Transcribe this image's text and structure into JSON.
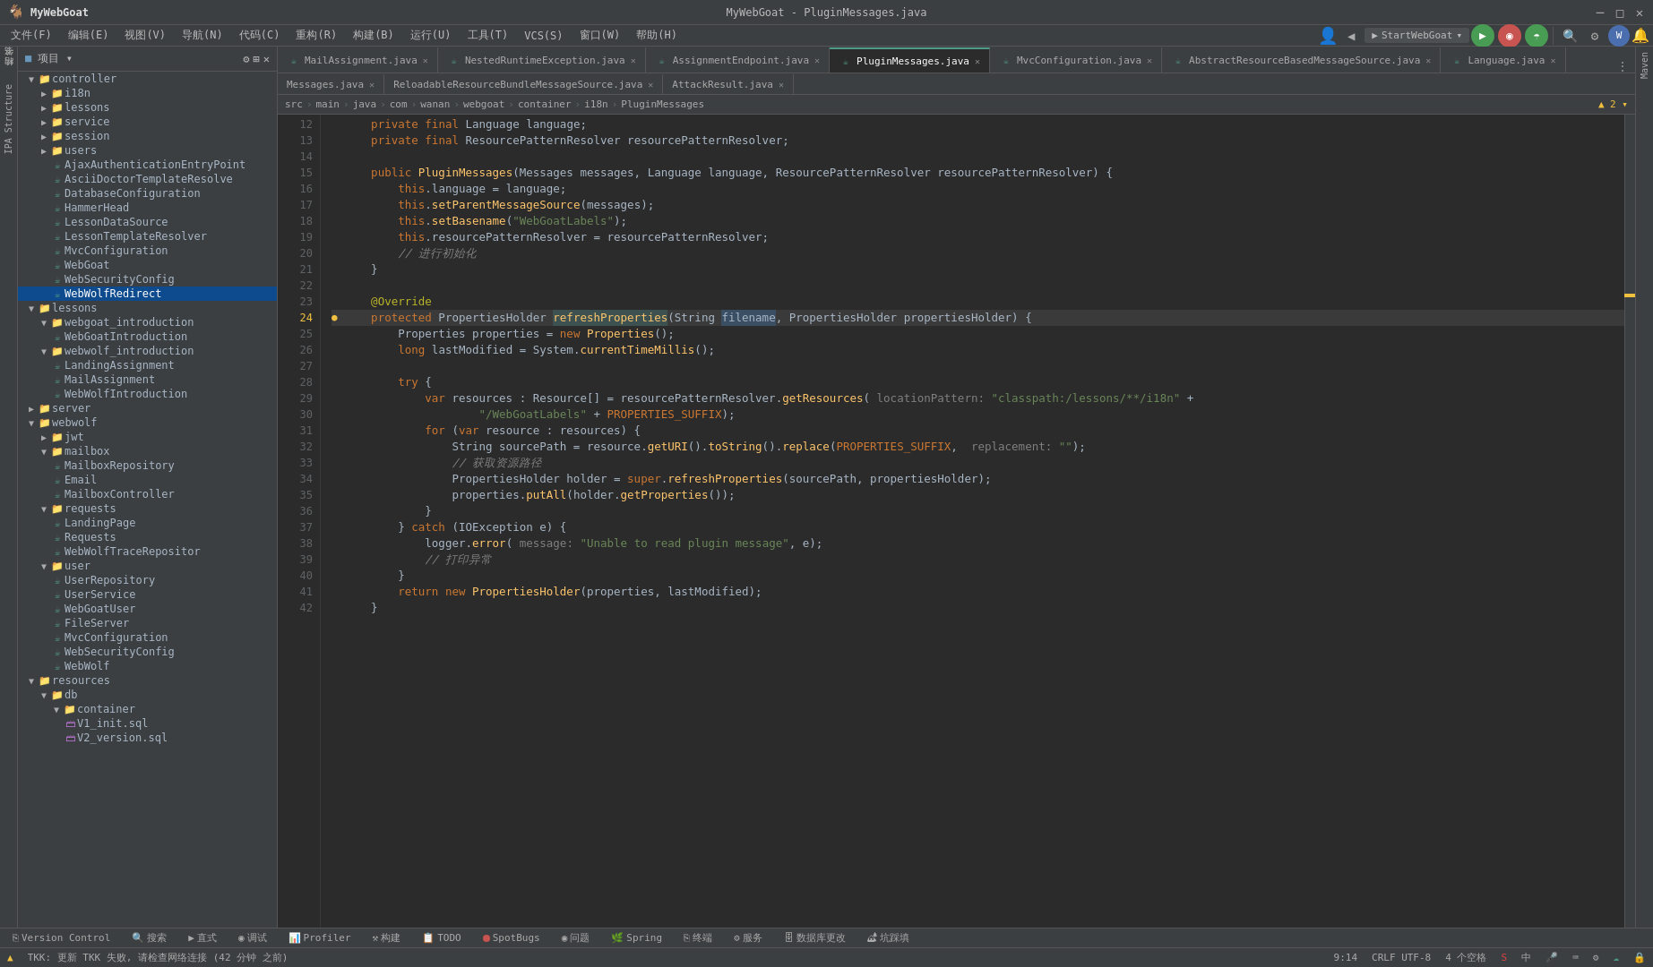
{
  "window": {
    "title": "MyWebGoat - PluginMessages.java",
    "app_name": "MyWebGoat"
  },
  "menu": {
    "items": [
      "文件(F)",
      "编辑(E)",
      "视图(V)",
      "导航(N)",
      "代码(C)",
      "重构(R)",
      "构建(B)",
      "运行(U)",
      "工具(T)",
      "VCS(S)",
      "窗口(W)",
      "帮助(H)"
    ]
  },
  "breadcrumb": {
    "parts": [
      "src",
      "main",
      "java",
      "com",
      "wanan",
      "webgoat",
      "container",
      "i18n",
      "PluginMessages"
    ]
  },
  "tabs": [
    {
      "label": "MailAssignment.java",
      "active": false,
      "dot": "none"
    },
    {
      "label": "NestedRuntimeException.java",
      "active": false,
      "dot": "none"
    },
    {
      "label": "AssignmentEndpoint.java",
      "active": false,
      "dot": "none"
    },
    {
      "label": "PluginMessages.java",
      "active": true,
      "dot": "blue"
    },
    {
      "label": "MvcConfiguration.java",
      "active": false,
      "dot": "none"
    },
    {
      "label": "AbstractResourceBasedMessageSource.java",
      "active": false,
      "dot": "none"
    },
    {
      "label": "Language.java",
      "active": false,
      "dot": "none"
    }
  ],
  "file_tabs_row2": [
    {
      "label": "Messages.java"
    },
    {
      "label": "ReloadableResourceBundleMessageSource.java"
    },
    {
      "label": "AttackResult.java"
    }
  ],
  "sidebar": {
    "header": "项目",
    "tree": [
      {
        "level": 1,
        "type": "folder",
        "label": "controller",
        "expanded": true
      },
      {
        "level": 2,
        "type": "folder",
        "label": "i18n",
        "expanded": false
      },
      {
        "level": 2,
        "type": "folder",
        "label": "lessons",
        "expanded": false
      },
      {
        "level": 2,
        "type": "folder",
        "label": "service",
        "expanded": false
      },
      {
        "level": 2,
        "type": "folder",
        "label": "session",
        "expanded": false
      },
      {
        "level": 2,
        "type": "folder",
        "label": "users",
        "expanded": false
      },
      {
        "level": 2,
        "type": "file",
        "label": "AjaxAuthenticationEntryPoint",
        "file_type": "java"
      },
      {
        "level": 2,
        "type": "file",
        "label": "AsciiDoctorTemplateResolve",
        "file_type": "java"
      },
      {
        "level": 2,
        "type": "file",
        "label": "DatabaseConfiguration",
        "file_type": "java"
      },
      {
        "level": 2,
        "type": "file",
        "label": "HammerHead",
        "file_type": "java"
      },
      {
        "level": 2,
        "type": "file",
        "label": "LessonDataSource",
        "file_type": "java"
      },
      {
        "level": 2,
        "type": "file",
        "label": "LessonTemplateResolver",
        "file_type": "java"
      },
      {
        "level": 2,
        "type": "file",
        "label": "MvcConfiguration",
        "file_type": "java"
      },
      {
        "level": 2,
        "type": "file",
        "label": "WebGoat",
        "file_type": "java"
      },
      {
        "level": 2,
        "type": "file",
        "label": "WebSecurityConfig",
        "file_type": "java"
      },
      {
        "level": 2,
        "type": "file",
        "label": "WebWolfRedirect",
        "file_type": "java",
        "selected": true
      },
      {
        "level": 1,
        "type": "folder",
        "label": "lessons",
        "expanded": true
      },
      {
        "level": 2,
        "type": "folder",
        "label": "webgoat_introduction",
        "expanded": true
      },
      {
        "level": 3,
        "type": "file",
        "label": "WebGoatIntroduction",
        "file_type": "java"
      },
      {
        "level": 2,
        "type": "folder",
        "label": "webwolf_introduction",
        "expanded": true
      },
      {
        "level": 3,
        "type": "file",
        "label": "LandingAssignment",
        "file_type": "java"
      },
      {
        "level": 3,
        "type": "file",
        "label": "MailAssignment",
        "file_type": "java"
      },
      {
        "level": 3,
        "type": "file",
        "label": "WebWolfIntroduction",
        "file_type": "java"
      },
      {
        "level": 1,
        "type": "folder",
        "label": "server",
        "expanded": false
      },
      {
        "level": 1,
        "type": "folder",
        "label": "webwolf",
        "expanded": true
      },
      {
        "level": 2,
        "type": "folder",
        "label": "jwt",
        "expanded": false
      },
      {
        "level": 2,
        "type": "folder",
        "label": "mailbox",
        "expanded": true
      },
      {
        "level": 3,
        "type": "file",
        "label": "MailboxRepository",
        "file_type": "java"
      },
      {
        "level": 3,
        "type": "file",
        "label": "Email",
        "file_type": "java"
      },
      {
        "level": 3,
        "type": "file",
        "label": "MailboxController",
        "file_type": "java"
      },
      {
        "level": 2,
        "type": "folder",
        "label": "requests",
        "expanded": true
      },
      {
        "level": 3,
        "type": "file",
        "label": "LandingPage",
        "file_type": "java"
      },
      {
        "level": 3,
        "type": "file",
        "label": "Requests",
        "file_type": "java"
      },
      {
        "level": 3,
        "type": "file",
        "label": "WebWolfTraceRepositor",
        "file_type": "java"
      },
      {
        "level": 2,
        "type": "folder",
        "label": "user",
        "expanded": true
      },
      {
        "level": 3,
        "type": "file",
        "label": "UserRepository",
        "file_type": "java"
      },
      {
        "level": 3,
        "type": "file",
        "label": "UserService",
        "file_type": "java"
      },
      {
        "level": 3,
        "type": "file",
        "label": "WebGoatUser",
        "file_type": "java"
      },
      {
        "level": 2,
        "type": "file",
        "label": "FileServer",
        "file_type": "java"
      },
      {
        "level": 2,
        "type": "file",
        "label": "MvcConfiguration",
        "file_type": "java"
      },
      {
        "level": 2,
        "type": "file",
        "label": "WebSecurityConfig",
        "file_type": "java"
      },
      {
        "level": 2,
        "type": "file",
        "label": "WebWolf",
        "file_type": "java"
      },
      {
        "level": 1,
        "type": "folder",
        "label": "resources",
        "expanded": true
      },
      {
        "level": 2,
        "type": "folder",
        "label": "db",
        "expanded": true
      },
      {
        "level": 3,
        "type": "folder",
        "label": "container",
        "expanded": true
      },
      {
        "level": 4,
        "type": "file",
        "label": "V1_init.sql",
        "file_type": "sql"
      },
      {
        "level": 4,
        "type": "file",
        "label": "V2_version.sql",
        "file_type": "sql"
      }
    ]
  },
  "code": {
    "lines": [
      {
        "num": 12,
        "content": "    <kw>private</kw> <kw>final</kw> Language language;"
      },
      {
        "num": 13,
        "content": "    <kw>private</kw> <kw>final</kw> ResourcePatternResolver resourcePatternResolver;"
      },
      {
        "num": 14,
        "content": ""
      },
      {
        "num": 15,
        "content": "    <kw>public</kw> <fn>PluginMessages</fn>(Messages messages, Language language, ResourcePatternResolver resourcePatternResolver) {"
      },
      {
        "num": 16,
        "content": "        <kw>this</kw>.language = language;"
      },
      {
        "num": 17,
        "content": "        <kw>this</kw>.<fn>setParentMessageSource</fn>(messages);"
      },
      {
        "num": 18,
        "content": "        <kw>this</kw>.<fn>setBasename</fn>(<str>\"WebGoatLabels\"</str>);"
      },
      {
        "num": 19,
        "content": "        <kw>this</kw>.resourcePatternResolver = resourcePatternResolver;"
      },
      {
        "num": 20,
        "content": "        <comment>// 进行初始化</comment>"
      },
      {
        "num": 21,
        "content": "    }"
      },
      {
        "num": 22,
        "content": ""
      },
      {
        "num": 23,
        "content": "    <ann>@Override</ann>"
      },
      {
        "num": 24,
        "content": "    <kw>protected</kw> PropertiesHolder <fn>refreshProperties</fn>(String <hvar>filename</hvar>, PropertiesHolder propertiesHolder) {",
        "marker": "●"
      },
      {
        "num": 25,
        "content": "        Properties properties = <kw>new</kw> <fn>Properties</fn>();"
      },
      {
        "num": 26,
        "content": "        <kw>long</kw> lastModified = System.<fn>currentTimeMillis</fn>();"
      },
      {
        "num": 27,
        "content": ""
      },
      {
        "num": 28,
        "content": "        <kw>try</kw> {"
      },
      {
        "num": 29,
        "content": "            <kw>var</kw> resources : Resource[] = resourcePatternResolver.<fn>getResources</fn>( <gray>locationPattern: </gray><str>\"classpath:/lessons/**/i18n\"</str> +"
      },
      {
        "num": 30,
        "content": "                    <str>\"/WebGoatLabels\"</str> + <kw>PROPERTIES_SUFFIX</kw>);"
      },
      {
        "num": 31,
        "content": "            <kw>for</kw> (<kw>var</kw> resource : resources) {"
      },
      {
        "num": 32,
        "content": "                String sourcePath = resource.<fn>getURI</fn>().<fn>toString</fn>().<fn>replace</fn>(<kw>PROPERTIES_SUFFIX</kw>, <gray>replacement: </gray><str>\"\"</str>);"
      },
      {
        "num": 33,
        "content": "                <comment>// 获取资源路径</comment>"
      },
      {
        "num": 34,
        "content": "                PropertiesHolder holder = <kw>super</kw>.<fn>refreshProperties</fn>(sourcePath, propertiesHolder);"
      },
      {
        "num": 35,
        "content": "                properties.<fn>putAll</fn>(holder.<fn>getProperties</fn>());"
      },
      {
        "num": 36,
        "content": "            }"
      },
      {
        "num": 37,
        "content": "        } <kw>catch</kw> (IOException e) {"
      },
      {
        "num": 38,
        "content": "            logger.<fn>error</fn>( <gray>message: </gray><str>\"Unable to read plugin message\"</str>, e);"
      },
      {
        "num": 39,
        "content": "            <comment>// 打印异常</comment>"
      },
      {
        "num": 40,
        "content": "        }"
      },
      {
        "num": 41,
        "content": "        <kw>return</kw> <kw>new</kw> <fn>PropertiesHolder</fn>(properties, lastModified);"
      },
      {
        "num": 42,
        "content": "    }"
      }
    ]
  },
  "status_bar": {
    "version_control": "Version Control",
    "search": "Q 搜索",
    "run": "▶ 直式",
    "debug": "◉ 调试",
    "profiler": "Profiler",
    "build": "⚒ 构建",
    "mic": "🎤 消声",
    "spot_bugs": "SpotBugs",
    "problems": "◉ 问题",
    "spring": "🌿 Spring",
    "terminal": "⎘ 终端",
    "services": "⚙ 服务",
    "database": "🗄 数据库更改",
    "todo": "📋 坑踩填",
    "position": "9:14",
    "encoding": "CRLF  UTF-8",
    "spaces": "4 个空格",
    "warning": "▲ 2"
  },
  "bottom_status": {
    "tkk_msg": "TKK: 更新 TKK 失败, 请检查网络连接 (42 分钟 之前)"
  },
  "run_config": {
    "label": "StartWebGoat"
  }
}
